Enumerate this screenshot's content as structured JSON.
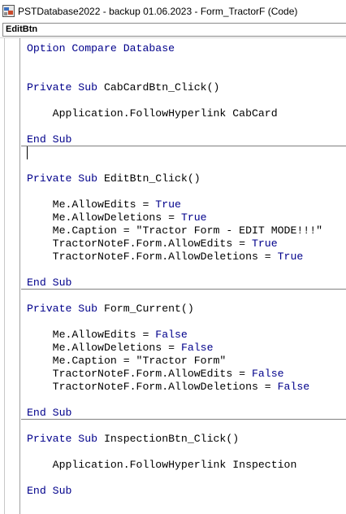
{
  "window": {
    "title": "PSTDatabase2022 - backup 01.06.2023 - Form_TractorF (Code)",
    "icon": "vba-module-icon"
  },
  "object_combo": {
    "value": "EditBtn"
  },
  "code": {
    "option": "Option Compare Database",
    "l_cab_sub": "Private Sub CabCardBtn_Click()",
    "l_cab_body": "    Application.FollowHyperlink CabCard",
    "l_cab_end": "End Sub",
    "l_edit_sub": "Private Sub EditBtn_Click()",
    "l_edit_1": "    Me.AllowEdits = True",
    "l_edit_2": "    Me.AllowDeletions = True",
    "l_edit_3": "    Me.Caption = \"Tractor Form - EDIT MODE!!!\"",
    "l_edit_4": "    TractorNoteF.Form.AllowEdits = True",
    "l_edit_5": "    TractorNoteF.Form.AllowDeletions = True",
    "l_edit_end": "End Sub",
    "l_cur_sub": "Private Sub Form_Current()",
    "l_cur_1": "    Me.AllowEdits = False",
    "l_cur_2": "    Me.AllowDeletions = False",
    "l_cur_3": "    Me.Caption = \"Tractor Form\"",
    "l_cur_4": "    TractorNoteF.Form.AllowEdits = False",
    "l_cur_5": "    TractorNoteF.Form.AllowDeletions = False",
    "l_cur_end": "End Sub",
    "l_insp_sub": "Private Sub InspectionBtn_Click()",
    "l_insp_body": "    Application.FollowHyperlink Inspection",
    "l_insp_end": "End Sub"
  },
  "colors": {
    "keyword": "#00008b",
    "text": "#000000",
    "separator": "#808080"
  }
}
